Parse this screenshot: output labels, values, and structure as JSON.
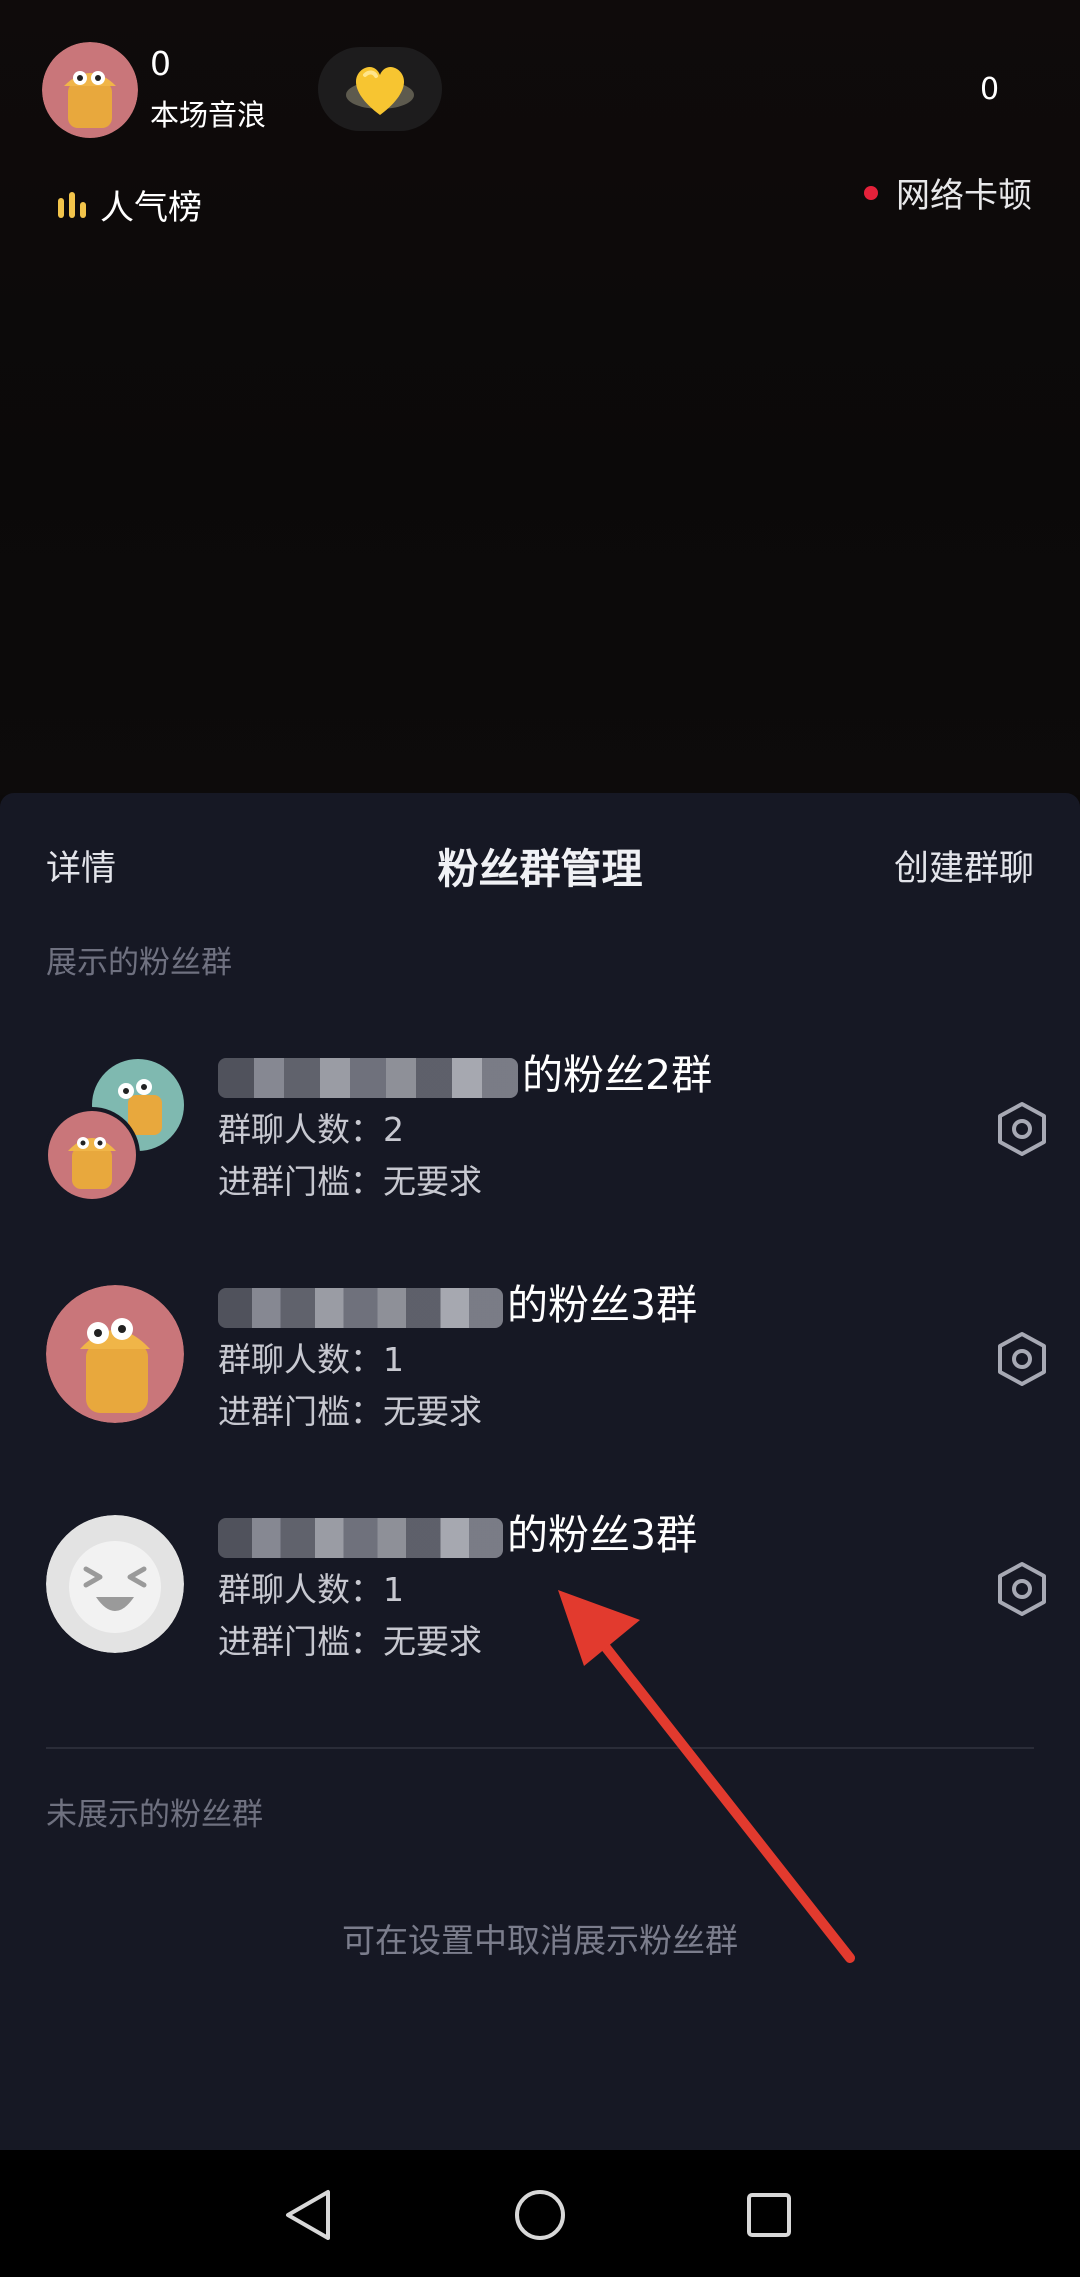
{
  "overlay": {
    "score": "0",
    "score_label": "本场音浪",
    "right_count": "0",
    "rank_label": "人气榜",
    "network_status": "网络卡顿"
  },
  "sheet": {
    "left_action": "详情",
    "title": "粉丝群管理",
    "right_action": "创建群聊",
    "shown_section": "展示的粉丝群",
    "groups": [
      {
        "name_suffix": "的粉丝2群",
        "members": "群聊人数：2",
        "threshold": "进群门槛：无要求",
        "avatar": "stacked-double-avatar"
      },
      {
        "name_suffix": "的粉丝3群",
        "members": "群聊人数：1",
        "threshold": "进群门槛：无要求",
        "avatar": "orange-character-avatar"
      },
      {
        "name_suffix": "的粉丝3群",
        "members": "群聊人数：1",
        "threshold": "进群门槛：无要求",
        "avatar": "grey-laughing-avatar"
      }
    ],
    "hidden_section": "未展示的粉丝群",
    "hidden_hint": "可在设置中取消展示粉丝群"
  },
  "colors": {
    "sheet_bg": "#161824",
    "live_bg": "#0c0a0a",
    "network_dot": "#e5213a",
    "rank_icon": "#f2c44b",
    "annotation_arrow": "#e23a2e"
  },
  "navbar": {
    "icons": [
      "back-icon",
      "home-icon",
      "recents-icon"
    ]
  }
}
